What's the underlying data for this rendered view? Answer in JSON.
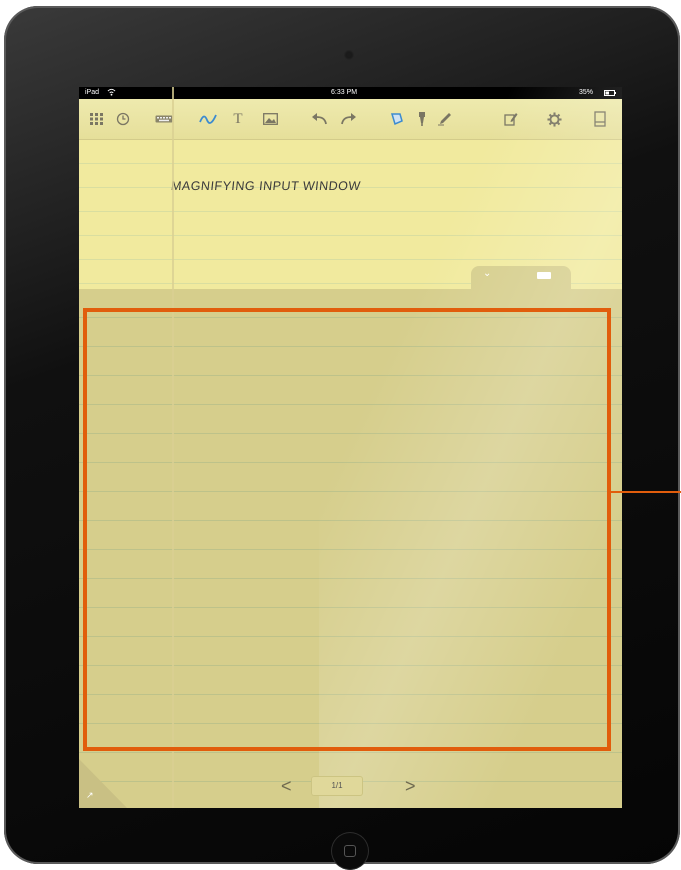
{
  "status_bar": {
    "carrier": "iPad",
    "wifi_icon": "wifi-icon",
    "time": "6:33 PM",
    "battery": "35%"
  },
  "toolbar": {
    "items": [
      {
        "name": "grid-icon"
      },
      {
        "name": "clock-icon"
      },
      {
        "name": "keyboard-icon"
      },
      {
        "name": "pen-icon"
      },
      {
        "name": "text-icon"
      },
      {
        "name": "image-icon"
      },
      {
        "name": "undo-icon"
      },
      {
        "name": "redo-icon"
      },
      {
        "name": "shape-icon"
      },
      {
        "name": "highlighter-icon"
      },
      {
        "name": "marker-icon"
      },
      {
        "name": "edit-icon"
      },
      {
        "name": "gear-icon"
      },
      {
        "name": "bookmark-icon"
      }
    ],
    "text_tool_label": "T"
  },
  "note": {
    "heading_text": "MAGNIFYING INPUT WINDOW"
  },
  "input_panel": {
    "collapse_icon": "chevron-down-icon",
    "keyboard_icon": "keyboard-icon"
  },
  "pager": {
    "prev": "<",
    "page_label": "1/1",
    "next": ">"
  },
  "colors": {
    "paper": "#f1ea9e",
    "panel": "#d6ce8c",
    "highlight": "#e15d0c",
    "bezel": "#101010"
  }
}
